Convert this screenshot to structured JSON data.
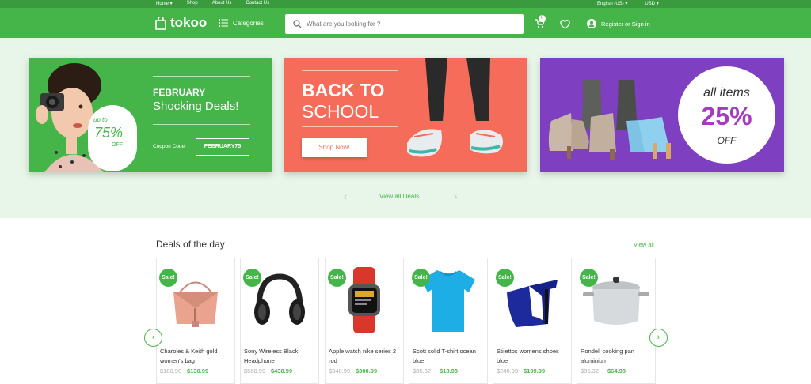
{
  "topbar": {
    "left": [
      "Home ▾",
      "Shop",
      "About Us",
      "Contact Us"
    ],
    "right": [
      "English (US) ▾",
      "USD ▾"
    ]
  },
  "header": {
    "logo": "tokoo",
    "categories": "Categories",
    "search_placeholder": "What are you looking for ?",
    "cart_count": "0",
    "signin": "Register or Sign in"
  },
  "colors": {
    "brand": "#46b549",
    "coral": "#f56c5b",
    "purple": "#7e3fc0",
    "accent_pink": "#a33ac0"
  },
  "banners": {
    "b1": {
      "upto": "up to",
      "pct": "75%",
      "off": "OFF",
      "title1": "FEBRUARY",
      "title2": "Shocking Deals!",
      "coupon_label": "Coupon Code",
      "coupon": "FEBRUARY75"
    },
    "b2": {
      "line1": "BACK TO",
      "line2": "SCHOOL",
      "button": "Shop Now!"
    },
    "b3": {
      "all": "all items",
      "pct": "25%",
      "off": "OFF"
    }
  },
  "view_all_deals": "View all Deals",
  "deals": {
    "title": "Deals of the day",
    "view_all": "View all",
    "sale_label": "Sale!",
    "products": [
      {
        "name": "Charoles & Keith gold women's bag",
        "old": "$180.90",
        "new": "$130.99",
        "icon": "bag-image"
      },
      {
        "name": "Sony Wireless Black Headphone",
        "old": "$560.99",
        "new": "$430.99",
        "icon": "headphone-image"
      },
      {
        "name": "Apple watch nike series 2 rod",
        "old": "$340.99",
        "new": "$300.99",
        "icon": "watch-image"
      },
      {
        "name": "Scott solid T-shirt ocean blue",
        "old": "$85.32",
        "new": "$18.98",
        "icon": "tshirt-image"
      },
      {
        "name": "Stilettos womens shoes blue",
        "old": "$240.99",
        "new": "$199.99",
        "icon": "heels-image"
      },
      {
        "name": "Rondell cooking pan aluminium",
        "old": "$85.32",
        "new": "$64.98",
        "icon": "pot-image"
      }
    ]
  }
}
